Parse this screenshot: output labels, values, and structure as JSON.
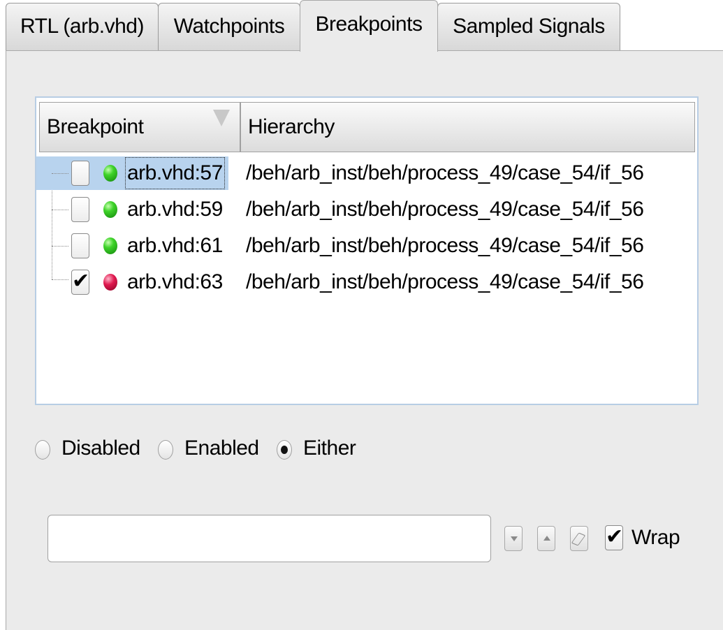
{
  "tabs": [
    {
      "label": "RTL (arb.vhd)",
      "active": false
    },
    {
      "label": "Watchpoints",
      "active": false
    },
    {
      "label": "Breakpoints",
      "active": true
    },
    {
      "label": "Sampled Signals",
      "active": false
    }
  ],
  "table": {
    "columns": [
      "Breakpoint",
      "Hierarchy"
    ],
    "rows": [
      {
        "checked": false,
        "state": "green",
        "label": "arb.vhd:57",
        "hierarchy": "/beh/arb_inst/beh/process_49/case_54/if_56",
        "selected": true
      },
      {
        "checked": false,
        "state": "green",
        "label": "arb.vhd:59",
        "hierarchy": "/beh/arb_inst/beh/process_49/case_54/if_56",
        "selected": false
      },
      {
        "checked": false,
        "state": "green",
        "label": "arb.vhd:61",
        "hierarchy": "/beh/arb_inst/beh/process_49/case_54/if_56",
        "selected": false
      },
      {
        "checked": true,
        "state": "red",
        "label": "arb.vhd:63",
        "hierarchy": "/beh/arb_inst/beh/process_49/case_54/if_56",
        "selected": false
      }
    ]
  },
  "filter": {
    "options": [
      "Disabled",
      "Enabled",
      "Either"
    ],
    "selected": "Either"
  },
  "search": {
    "value": "",
    "placeholder": ""
  },
  "wrap": {
    "label": "Wrap",
    "checked": true,
    "check_glyph": "✔"
  },
  "icons": {
    "find_next": "triangle-down-icon",
    "find_previous": "triangle-up-icon",
    "clear": "eraser-icon"
  },
  "colors": {
    "selection": "#b8d3ee",
    "enabled_dot": "#3fd32a",
    "disabled_dot": "#e0194f",
    "panel": "#ebebeb"
  }
}
